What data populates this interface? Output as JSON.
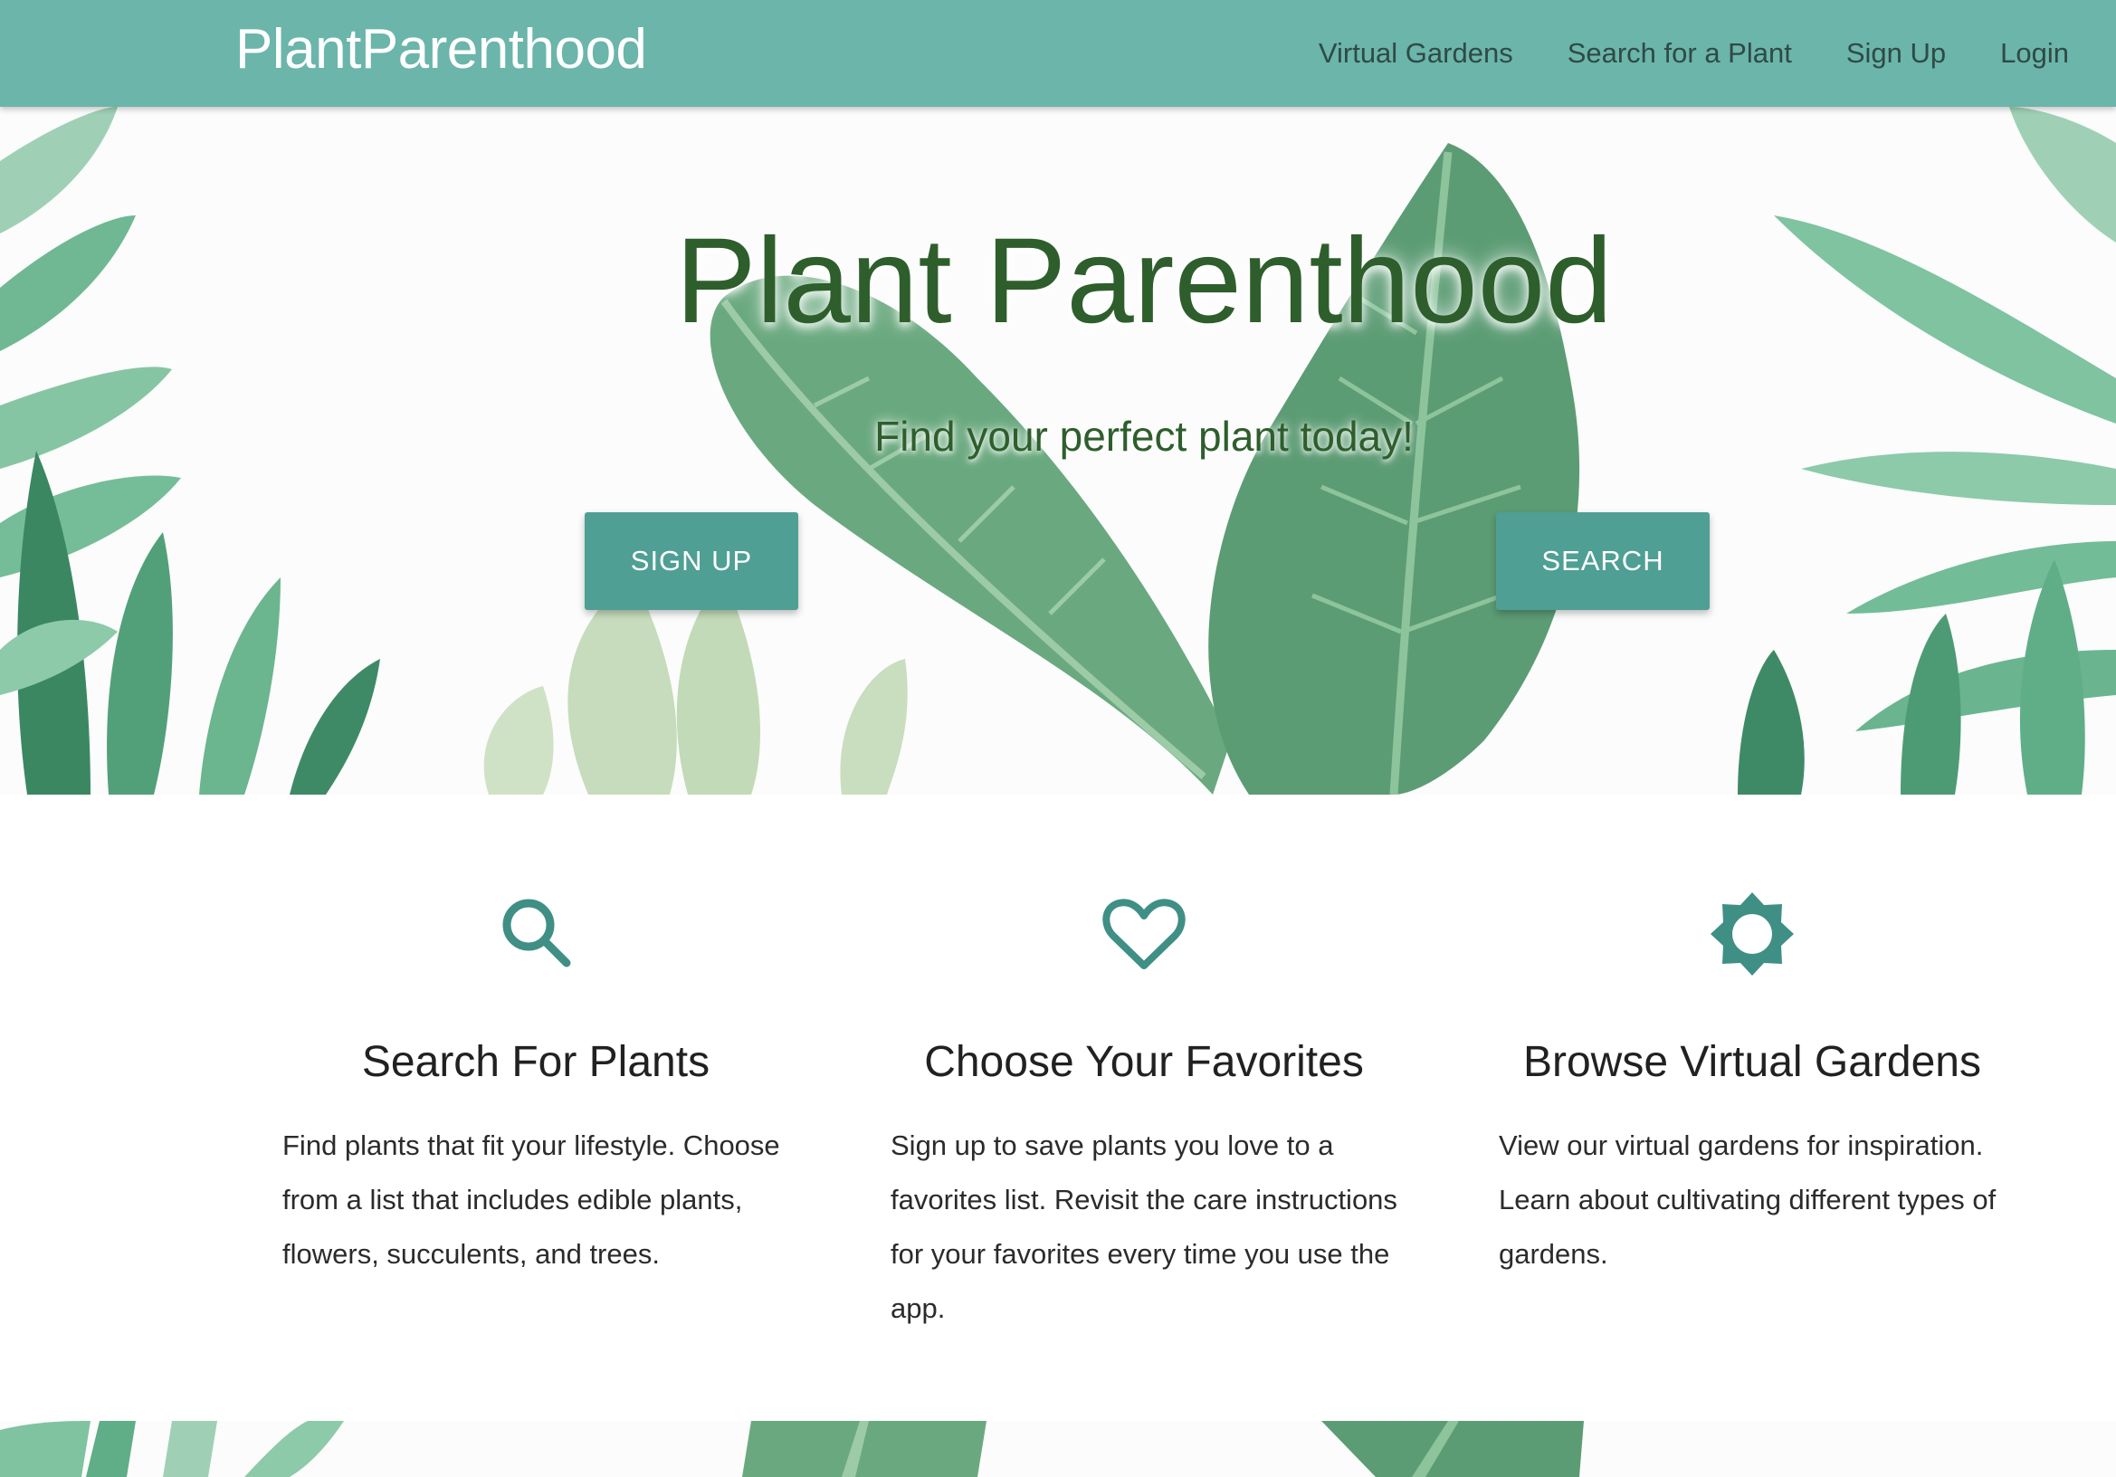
{
  "navbar": {
    "brand": "PlantParenthood",
    "links": [
      {
        "label": "Virtual Gardens"
      },
      {
        "label": "Search for a Plant"
      },
      {
        "label": "Sign Up"
      },
      {
        "label": "Login"
      }
    ],
    "background_color": "#6bb5ab"
  },
  "hero": {
    "title": "Plant Parenthood",
    "subtitle": "Find your perfect plant today!",
    "signup_button": "SIGN UP",
    "search_button": "SEARCH",
    "accent_color": "#4f9f94",
    "title_color": "#2e5e2c"
  },
  "features": [
    {
      "icon": "search-icon",
      "title": "Search For Plants",
      "description": "Find plants that fit your lifestyle. Choose from a list that includes edible plants, flowers, succulents, and trees."
    },
    {
      "icon": "heart-icon",
      "title": "Choose Your Favorites",
      "description": "Sign up to save plants you love to a favorites list. Revisit the care instructions for your favorites every time you use the app."
    },
    {
      "icon": "brightness-icon",
      "title": "Browse Virtual Gardens",
      "description": "View our virtual gardens for inspiration. Learn about cultivating different types of gardens."
    }
  ]
}
